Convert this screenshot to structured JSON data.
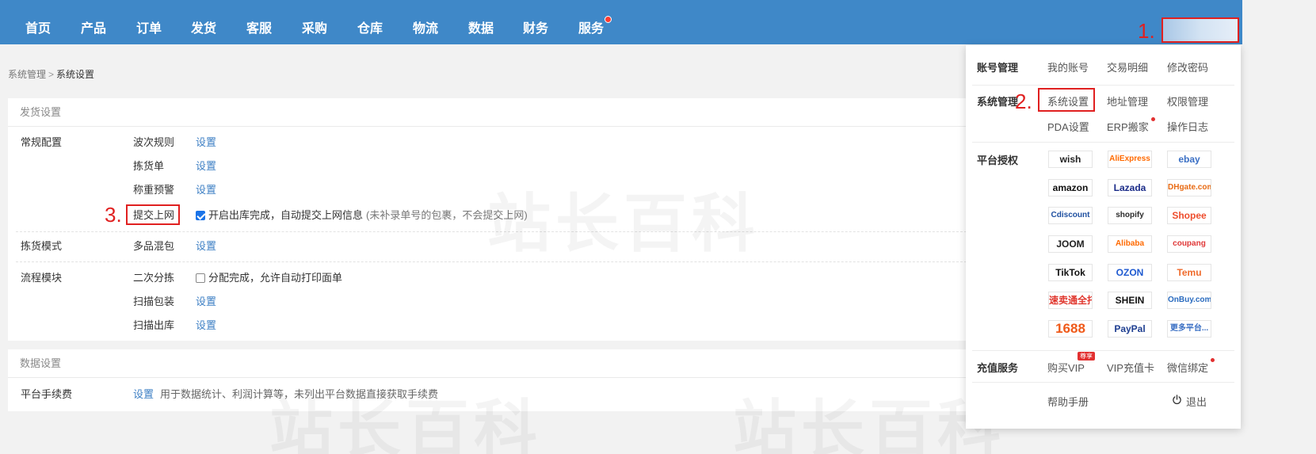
{
  "nav": {
    "items": [
      "首页",
      "产品",
      "订单",
      "发货",
      "客服",
      "采购",
      "仓库",
      "物流",
      "数据",
      "财务",
      "服务"
    ]
  },
  "markers": {
    "m1": "1.",
    "m2": "2.",
    "m3": "3."
  },
  "breadcrumb": {
    "parent": "系统管理",
    "separator": ">",
    "current": "系统设置"
  },
  "shipping": {
    "title": "发货设置",
    "regular_config": {
      "label": "常规配置",
      "wave_rule": {
        "label": "波次规则",
        "action": "设置"
      },
      "picking_list": {
        "label": "拣货单",
        "action": "设置"
      },
      "weight_warning": {
        "label": "称重预警",
        "action": "设置"
      },
      "submit_online": {
        "label": "提交上网",
        "checked": true,
        "text": "开启出库完成，自动提交上网信息",
        "hint": "(未补录单号的包裹，不会提交上网)"
      }
    },
    "picking_mode": {
      "label": "拣货模式",
      "multi_item": {
        "label": "多品混包",
        "action": "设置"
      }
    },
    "flow_module": {
      "label": "流程模块",
      "second_sort": {
        "label": "二次分拣",
        "checked": false,
        "text": "分配完成，允许自动打印面单"
      },
      "scan_pack": {
        "label": "扫描包装",
        "action": "设置"
      },
      "scan_out": {
        "label": "扫描出库",
        "action": "设置"
      }
    }
  },
  "data_settings": {
    "title": "数据设置",
    "platform_fee": {
      "label": "平台手续费",
      "action": "设置",
      "description": "用于数据统计、利润计算等，未列出平台数据直接获取手续费"
    }
  },
  "watermark": "站长百科",
  "dropdown": {
    "account": {
      "label": "账号管理",
      "links": [
        "我的账号",
        "交易明细",
        "修改密码"
      ]
    },
    "system": {
      "label": "系统管理",
      "links": [
        "系统设置",
        "地址管理",
        "权限管理",
        "PDA设置",
        "ERP搬家",
        "操作日志"
      ]
    },
    "platforms": {
      "label": "平台授权",
      "items": [
        "wish",
        "AliExpress",
        "ebay",
        "amazon",
        "Lazada",
        "DHgate.com",
        "Cdiscount",
        "shopify",
        "Shopee",
        "JOOM",
        "Alibaba",
        "coupang",
        "TikTok",
        "OZON",
        "Temu",
        "速卖通全托管",
        "SHEIN",
        "OnBuy.com",
        "1688",
        "PayPal",
        "更多平台..."
      ],
      "colors": [
        "#222222",
        "#ff6a00",
        "#3a6fc4",
        "#111111",
        "#1a2b88",
        "#e86a13",
        "#1e4fa0",
        "#2b2b2b",
        "#ee4d2d",
        "#222222",
        "#ff6a00",
        "#e03a3a",
        "#111111",
        "#1f5ad0",
        "#ef6b2c",
        "#e0372e",
        "#111111",
        "#2a6bbf",
        "#ef5a1a",
        "#1f3f91",
        "#3a6fc4"
      ]
    },
    "recharge": {
      "label": "充值服务",
      "links": [
        "购买VIP",
        "VIP充值卡",
        "微信绑定"
      ],
      "vip_badge": "尊享"
    },
    "help": "帮助手册",
    "logout": "退出"
  }
}
